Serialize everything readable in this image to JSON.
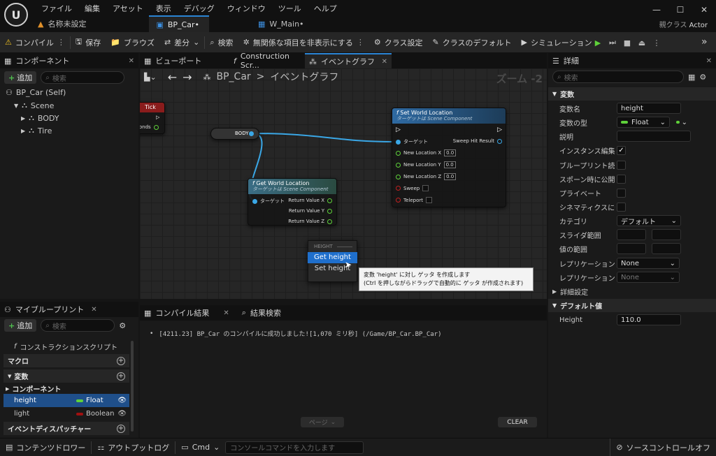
{
  "title_bar": {
    "logo": "U",
    "menu": [
      "ファイル",
      "編集",
      "アセット",
      "表示",
      "デバッグ",
      "ウィンドウ",
      "ツール",
      "ヘルプ"
    ],
    "tabs": [
      {
        "label": "名称未設定",
        "icon": "level-icon",
        "active": false
      },
      {
        "label": "BP_Car•",
        "icon": "blueprint-icon",
        "active": true
      },
      {
        "label": "W_Main•",
        "icon": "widget-icon",
        "active": false
      }
    ],
    "parent_class_label": "親クラス",
    "parent_class_value": "Actor"
  },
  "toolbar": {
    "compile": "コンパイル",
    "save": "保存",
    "browse": "ブラウズ",
    "diff": "差分",
    "find": "検索",
    "hide_unrelated": "無関係な項目を非表示にする",
    "class_settings": "クラス設定",
    "class_defaults": "クラスのデフォルト",
    "simulation": "シミュレーション"
  },
  "components_panel": {
    "title": "コンポーネント",
    "add": "追加",
    "search_placeholder": "検索",
    "tree": [
      {
        "label": "BP_Car (Self)",
        "depth": 0
      },
      {
        "label": "Scene",
        "depth": 1
      },
      {
        "label": "BODY",
        "depth": 2
      },
      {
        "label": "Tire",
        "depth": 2
      }
    ]
  },
  "graph_tabs": {
    "viewport": "ビューポート",
    "construction": "Construction Scr...",
    "event_graph": "イベントグラフ"
  },
  "graph": {
    "breadcrumb_root": "BP_Car",
    "breadcrumb_sep": ">",
    "breadcrumb_leaf": "イベントグラフ",
    "zoom": "ズーム -2",
    "tick_node": {
      "title": "Tick",
      "pin": "conds"
    },
    "body_node": {
      "label": "BODY"
    },
    "get_world_location": {
      "title": "Get World Location",
      "subtitle": "ターゲットは Scene Component",
      "target": "ターゲット",
      "outputs": [
        "Return Value X",
        "Return Value Y",
        "Return Value Z"
      ]
    },
    "set_world_location": {
      "title": "Set World Location",
      "subtitle": "ターゲットは Scene Component",
      "target": "ターゲット",
      "sweep_hit": "Sweep Hit Result",
      "inputs": [
        {
          "label": "New Location X",
          "value": "0.0"
        },
        {
          "label": "New Location Y",
          "value": "0.0"
        },
        {
          "label": "New Location Z",
          "value": "0.0"
        }
      ],
      "sweep": "Sweep",
      "teleport": "Teleport"
    },
    "context_menu": {
      "header": "HEIGHT",
      "items": [
        "Get height",
        "Set height"
      ]
    },
    "tooltip": {
      "line1": "変数 'height' に対し ゲッタ を作成します",
      "line2": "(Ctrl を押しながらドラッグで自動的に ゲッタ が作成されます)"
    }
  },
  "details_panel": {
    "title": "詳細",
    "search_placeholder": "検索",
    "variables_section": "変数",
    "rows": {
      "var_name_label": "変数名",
      "var_name_value": "height",
      "var_type_label": "変数の型",
      "var_type_value": "Float",
      "description_label": "説明",
      "instance_editable_label": "インスタンス編集可能",
      "blueprint_readonly_label": "ブループリント読み取り専用",
      "expose_on_spawn_label": "スポーン時に公開",
      "private_label": "プライベート",
      "cinematics_label": "シネマティクスに公開",
      "category_label": "カテゴリ",
      "category_value": "デフォルト",
      "slider_range_label": "スライダ範囲",
      "value_range_label": "値の範囲",
      "replication_label": "レプリケーション",
      "replication_value": "None",
      "replication_condition_label": "レプリケーション条件",
      "replication_condition_value": "None"
    },
    "advanced_section": "詳細設定",
    "default_value_section": "デフォルト値",
    "default_height_label": "Height",
    "default_height_value": "110.0"
  },
  "my_blueprint": {
    "title": "マイブループリント",
    "add": "追加",
    "search_placeholder": "検索",
    "construction_script": "コンストラクションスクリプト",
    "macros": "マクロ",
    "variables": "変数",
    "components": "コンポーネント",
    "vars": [
      {
        "name": "height",
        "type": "Float",
        "color": "#5fd13a"
      },
      {
        "name": "light",
        "type": "Boolean",
        "color": "#a01010"
      }
    ],
    "event_dispatchers": "イベントディスパッチャー"
  },
  "output": {
    "compile_tab": "コンパイル結果",
    "find_tab": "結果検索",
    "message": "[4211.23] BP_Car のコンパイルに成功しました![1,070 ミリ秒] (/Game/BP_Car.BP_Car)",
    "page_button": "ページ",
    "clear_button": "CLEAR"
  },
  "status_bar": {
    "content_drawer": "コンテンツドロワー",
    "output_log": "アウトプットログ",
    "cmd": "Cmd",
    "console_placeholder": "コンソールコマンドを入力します",
    "source_control": "ソースコントロールオフ"
  },
  "colors": {
    "accent_blue": "#1f6fcc",
    "float_green": "#5fd13a",
    "bool_red": "#a01010",
    "function_header": "#3b6e86"
  }
}
